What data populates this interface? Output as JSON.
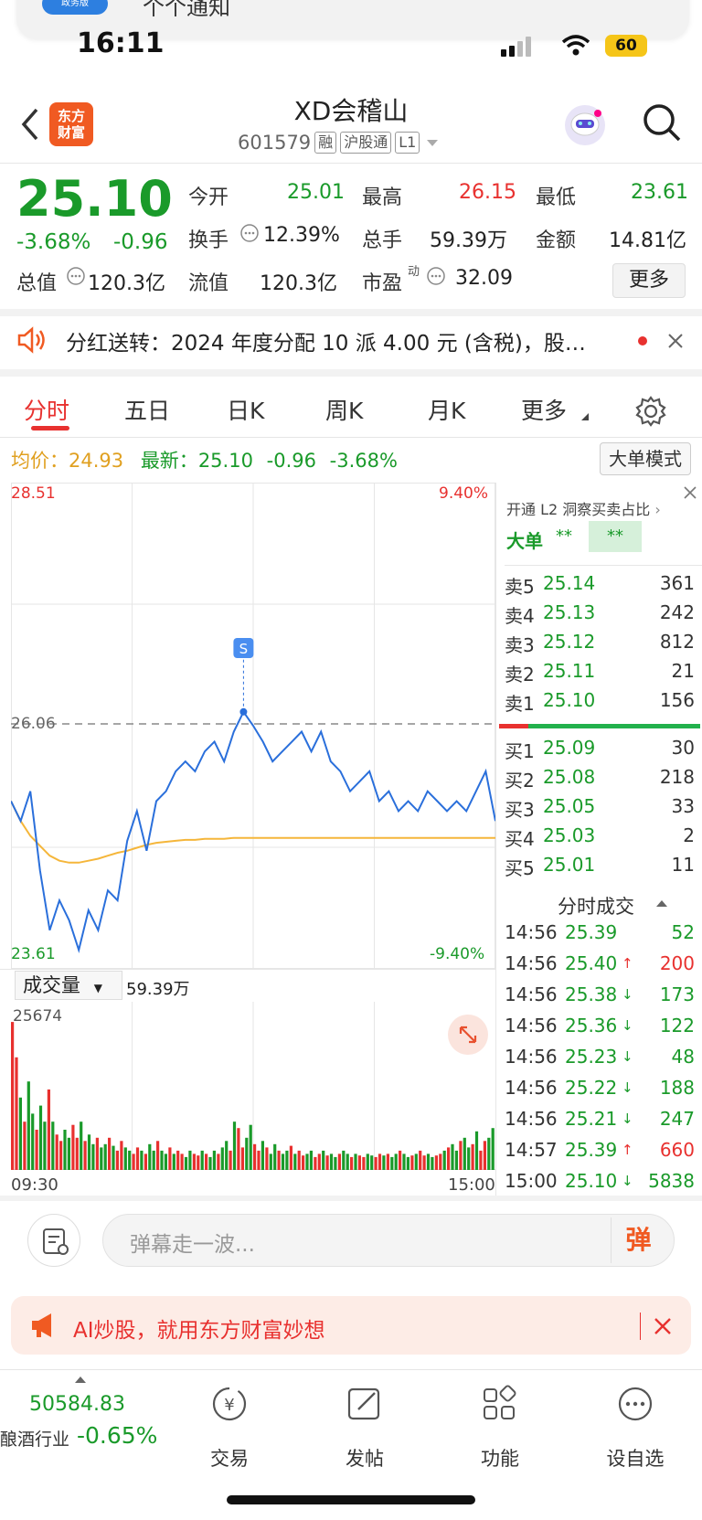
{
  "notification": {
    "badge": "政务版",
    "text": "个个通知"
  },
  "status_bar": {
    "time": "16:11",
    "battery": "60"
  },
  "header": {
    "title": "XD会稽山",
    "code": "601579",
    "tag_margin": "融",
    "tag_connect": "沪股通",
    "tag_level": "L1",
    "logo_line1": "东方",
    "logo_line2": "财富"
  },
  "quote": {
    "price": "25.10",
    "change_pct": "-3.68%",
    "change_val": "-0.96",
    "open_label": "今开",
    "open": "25.01",
    "high_label": "最高",
    "high": "26.15",
    "low_label": "最低",
    "low": "23.61",
    "turnover_label": "换手",
    "turnover": "12.39%",
    "volume_label": "总手",
    "volume": "59.39万",
    "amount_label": "金额",
    "amount": "14.81亿",
    "mktcap_label": "总值",
    "mktcap": "120.3亿",
    "float_label": "流值",
    "float_cap": "120.3亿",
    "pe_label": "市盈",
    "pe_sup": "动",
    "pe": "32.09",
    "more": "更多"
  },
  "announcement": {
    "text": "分红送转：2024 年度分配 10 派 4.00 元 (含税)，股…"
  },
  "tabs": [
    "分时",
    "五日",
    "日K",
    "周K",
    "月K",
    "更多"
  ],
  "avg_row": {
    "avg_label": "均价：",
    "avg": "24.93",
    "latest_label": "最新：",
    "latest": "25.10",
    "chg": "-0.96",
    "chg_pct": "-3.68%"
  },
  "big_order_mode": "大单模式",
  "chart_data": {
    "type": "line",
    "title": "",
    "y_max_label": "28.51",
    "y_min_label": "23.61",
    "y_mid_label": "26.06",
    "pct_max_label": "9.40%",
    "pct_min_label": "-9.40%",
    "ylim": [
      23.61,
      28.51
    ],
    "x_start": "09:30",
    "x_end": "15:00",
    "signal_marker": "S",
    "series": [
      {
        "name": "price",
        "color": "#2a6fdb",
        "values": [
          25.3,
          25.1,
          25.4,
          24.6,
          24.0,
          24.3,
          24.1,
          23.8,
          24.2,
          24.0,
          24.4,
          24.3,
          24.9,
          25.2,
          24.8,
          25.3,
          25.4,
          25.6,
          25.7,
          25.6,
          25.8,
          25.9,
          25.7,
          26.0,
          26.2,
          26.06,
          25.9,
          25.7,
          25.8,
          25.9,
          26.0,
          25.8,
          26.0,
          25.7,
          25.6,
          25.4,
          25.5,
          25.6,
          25.3,
          25.4,
          25.2,
          25.3,
          25.2,
          25.4,
          25.3,
          25.2,
          25.3,
          25.2,
          25.4,
          25.6,
          25.1
        ]
      },
      {
        "name": "avg",
        "color": "#f5b63a",
        "values": [
          25.3,
          25.1,
          24.95,
          24.85,
          24.75,
          24.7,
          24.68,
          24.68,
          24.7,
          24.72,
          24.75,
          24.78,
          24.8,
          24.83,
          24.86,
          24.88,
          24.89,
          24.9,
          24.91,
          24.91,
          24.92,
          24.92,
          24.92,
          24.93,
          24.93,
          24.93,
          24.93,
          24.93,
          24.93,
          24.93,
          24.93,
          24.93,
          24.93,
          24.93,
          24.93,
          24.93,
          24.93,
          24.93,
          24.93,
          24.93,
          24.93,
          24.93,
          24.93,
          24.93,
          24.93,
          24.93,
          24.93,
          24.93,
          24.93,
          24.93,
          24.93
        ]
      }
    ]
  },
  "volume": {
    "label": "成交量",
    "total": "59.39万",
    "max_label": "25674",
    "bars": [
      0.92,
      0.7,
      0.45,
      0.3,
      0.55,
      0.35,
      0.25,
      0.4,
      0.3,
      0.5,
      0.3,
      0.22,
      0.18,
      0.25,
      0.2,
      0.28,
      0.2,
      0.3,
      0.18,
      0.22,
      0.16,
      0.2,
      0.14,
      0.16,
      0.2,
      0.15,
      0.12,
      0.18,
      0.14,
      0.12,
      0.1,
      0.14,
      0.12,
      0.1,
      0.16,
      0.12,
      0.18,
      0.12,
      0.1,
      0.14,
      0.1,
      0.12,
      0.1,
      0.08,
      0.12,
      0.1,
      0.09,
      0.12,
      0.1,
      0.08,
      0.12,
      0.1,
      0.14,
      0.18,
      0.12,
      0.3,
      0.26,
      0.14,
      0.2,
      0.28,
      0.16,
      0.12,
      0.18,
      0.14,
      0.1,
      0.16,
      0.12,
      0.1,
      0.12,
      0.15,
      0.1,
      0.12,
      0.09,
      0.1,
      0.12,
      0.08,
      0.1,
      0.12,
      0.09,
      0.1,
      0.08,
      0.1,
      0.12,
      0.1,
      0.08,
      0.1,
      0.09,
      0.08,
      0.1,
      0.09,
      0.08,
      0.1,
      0.09,
      0.1,
      0.08,
      0.1,
      0.12,
      0.1,
      0.08,
      0.09,
      0.1,
      0.12,
      0.09,
      0.1,
      0.08,
      0.09,
      0.1,
      0.12,
      0.14,
      0.16,
      0.12,
      0.18,
      0.2,
      0.14,
      0.16,
      0.24,
      0.12,
      0.18,
      0.2,
      0.26
    ]
  },
  "l2": {
    "title": "开通 L2 洞察买卖占比",
    "big_order": "大单",
    "mask1": "**",
    "mask2": "**"
  },
  "order_book": {
    "asks": [
      {
        "label": "卖5",
        "price": "25.14",
        "vol": "361"
      },
      {
        "label": "卖4",
        "price": "25.13",
        "vol": "242"
      },
      {
        "label": "卖3",
        "price": "25.12",
        "vol": "812"
      },
      {
        "label": "卖2",
        "price": "25.11",
        "vol": "21"
      },
      {
        "label": "卖1",
        "price": "25.10",
        "vol": "156"
      }
    ],
    "bids": [
      {
        "label": "买1",
        "price": "25.09",
        "vol": "30"
      },
      {
        "label": "买2",
        "price": "25.08",
        "vol": "218"
      },
      {
        "label": "买3",
        "price": "25.05",
        "vol": "33"
      },
      {
        "label": "买4",
        "price": "25.03",
        "vol": "2"
      },
      {
        "label": "买5",
        "price": "25.01",
        "vol": "11"
      }
    ]
  },
  "trades": {
    "title": "分时成交",
    "rows": [
      {
        "t": "14:56",
        "p": "25.39",
        "v": "52",
        "d": ""
      },
      {
        "t": "14:56",
        "p": "25.40",
        "v": "200",
        "d": "↑"
      },
      {
        "t": "14:56",
        "p": "25.38",
        "v": "173",
        "d": "↓"
      },
      {
        "t": "14:56",
        "p": "25.36",
        "v": "122",
        "d": "↓"
      },
      {
        "t": "14:56",
        "p": "25.23",
        "v": "48",
        "d": "↓"
      },
      {
        "t": "14:56",
        "p": "25.22",
        "v": "188",
        "d": "↓"
      },
      {
        "t": "14:56",
        "p": "25.21",
        "v": "247",
        "d": "↓"
      },
      {
        "t": "14:57",
        "p": "25.39",
        "v": "660",
        "d": "↑"
      },
      {
        "t": "15:00",
        "p": "25.10",
        "v": "5838",
        "d": "↓"
      }
    ]
  },
  "comment": {
    "placeholder": "弹幕走一波...",
    "danmu": "弹"
  },
  "ai_banner": {
    "text": "AI炒股，就用东方财富妙想"
  },
  "bottom_nav": {
    "index_value": "50584.83",
    "index_name": "酿酒行业",
    "index_chg": "-0.65%",
    "items": [
      "交易",
      "发帖",
      "功能",
      "设自选"
    ]
  }
}
